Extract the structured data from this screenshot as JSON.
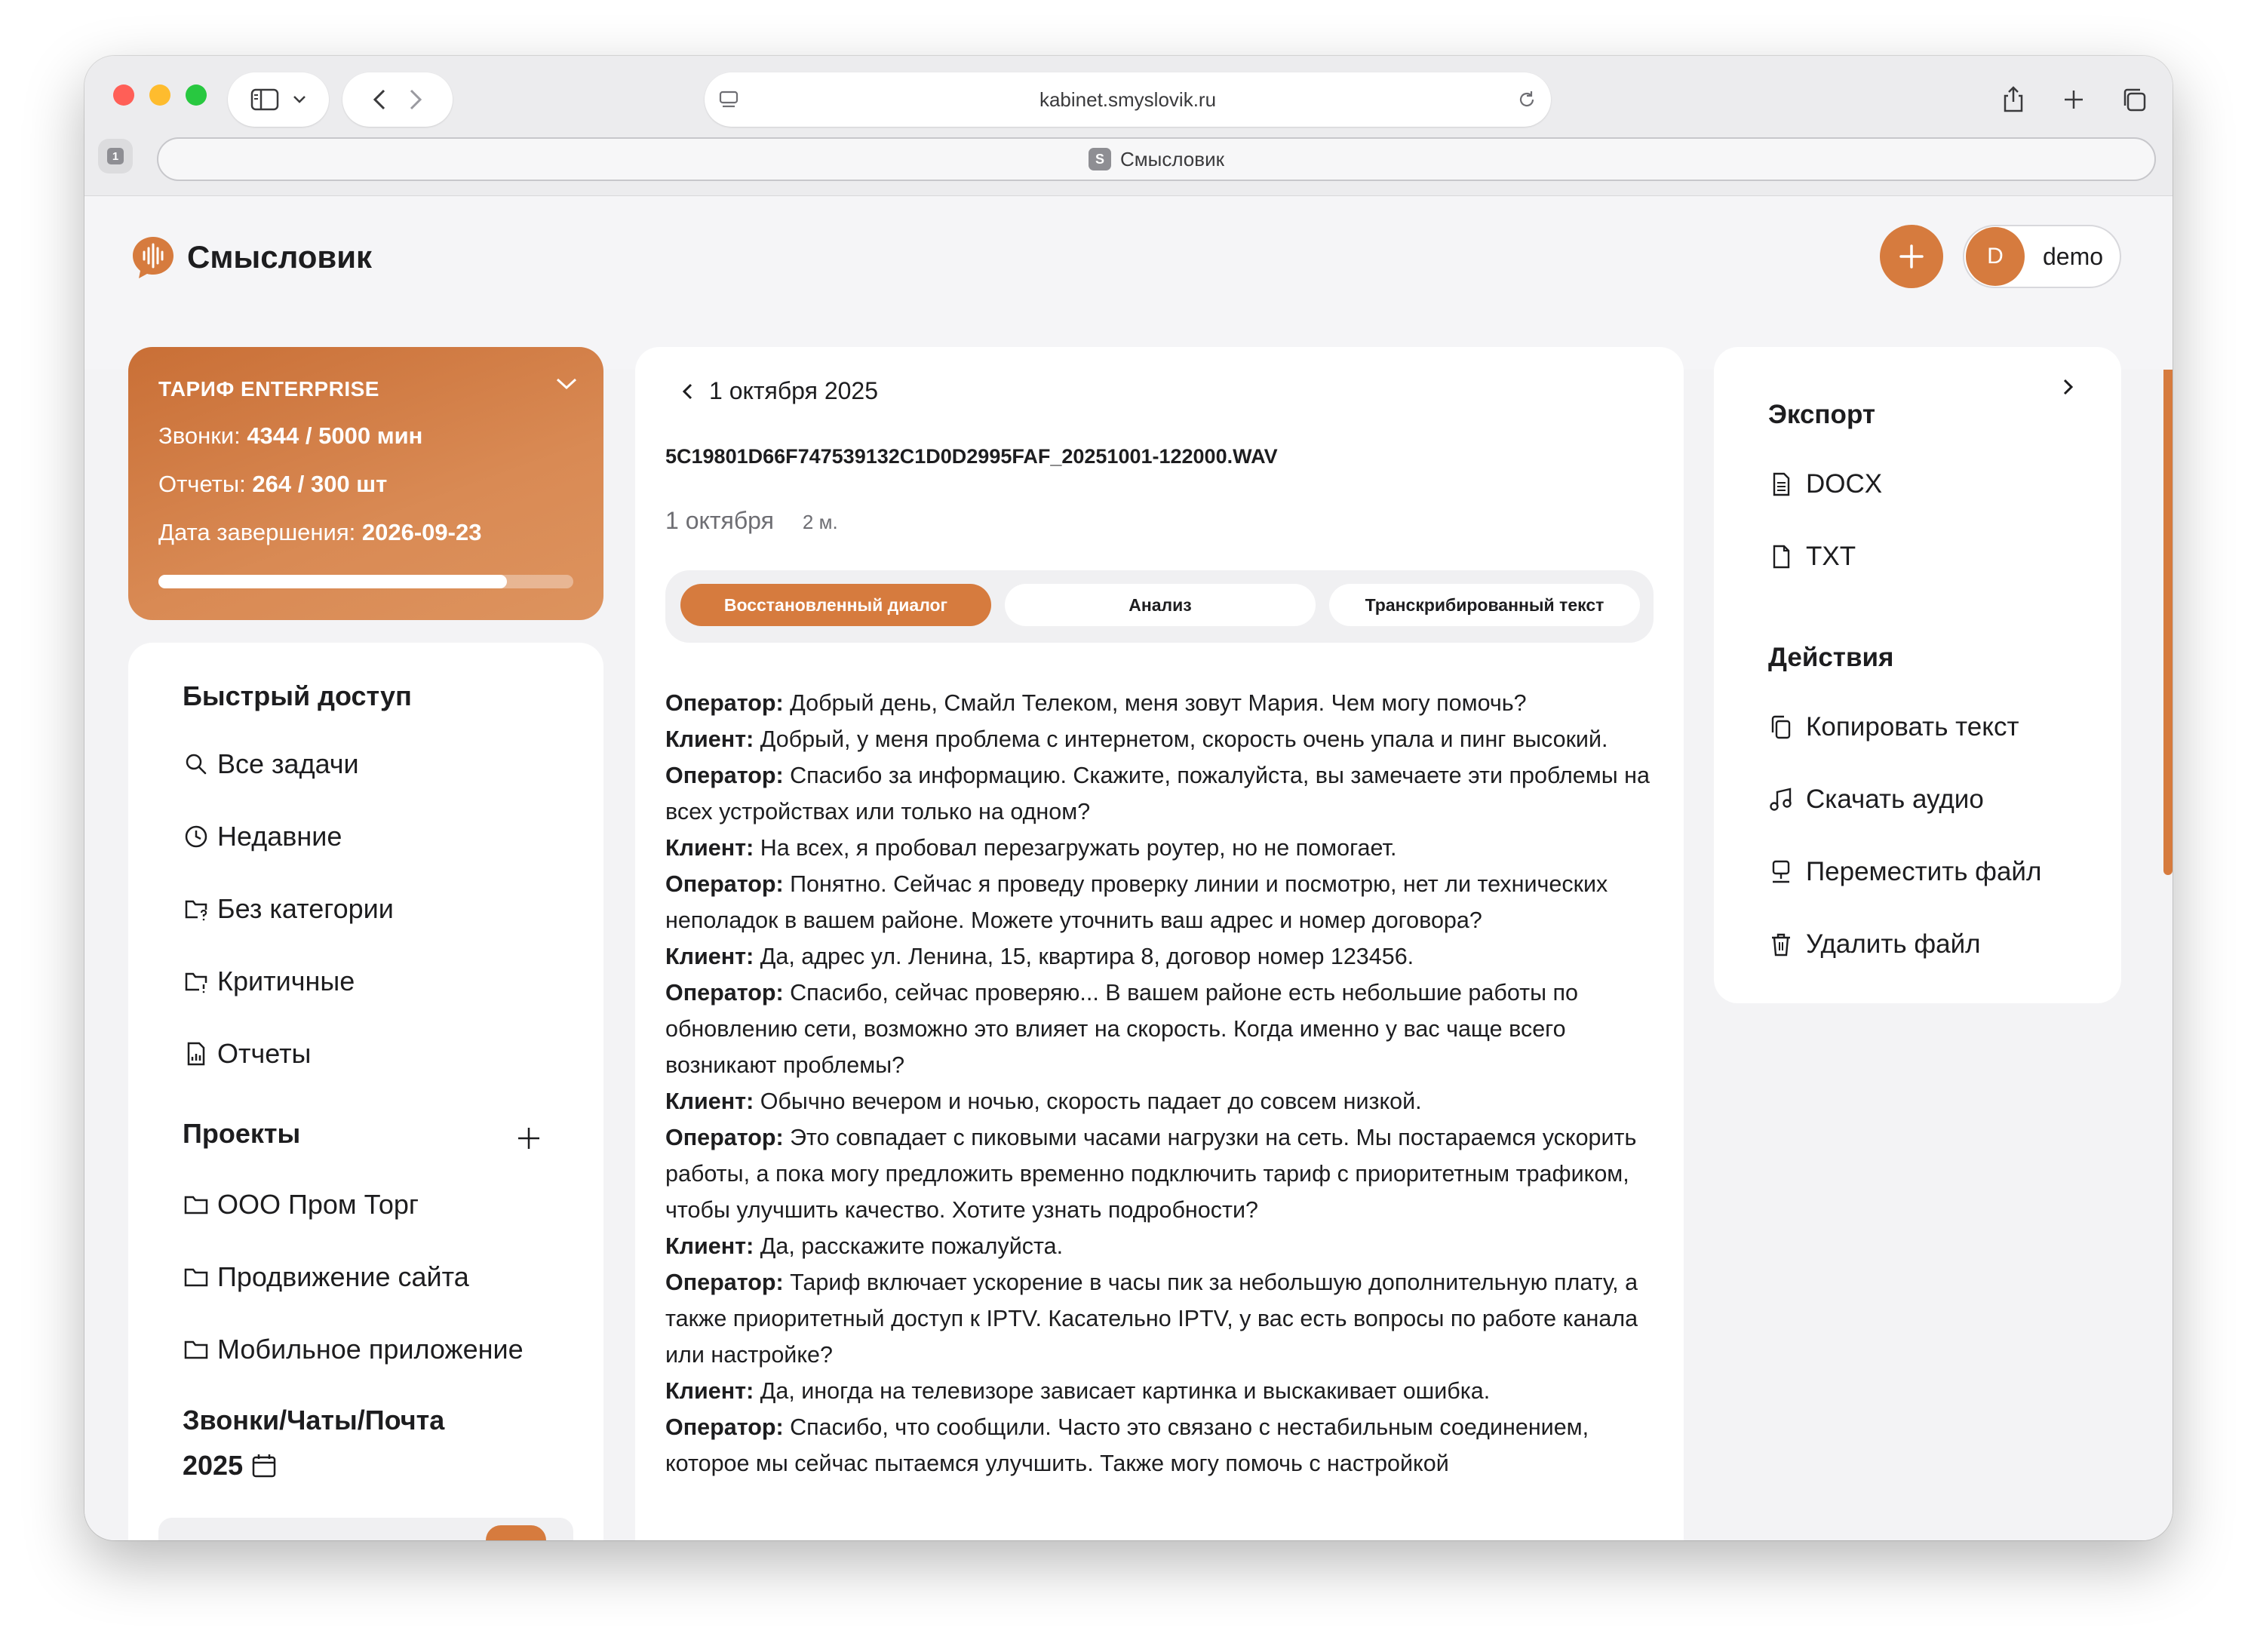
{
  "browser": {
    "url": "kabinet.smyslovik.ru",
    "tab_count": "1",
    "tab_title": "Смысловик",
    "favicon_letter": "S"
  },
  "app": {
    "logo_text": "Смысловик",
    "user": {
      "initial": "D",
      "name": "demo"
    },
    "accent_color": "#d67b3e"
  },
  "tariff": {
    "title": "ТАРИФ ENTERPRISE",
    "calls_label": "Звонки: ",
    "calls_value": "4344 / 5000 мин",
    "reports_label": "Отчеты: ",
    "reports_value": "264 / 300 шт",
    "end_label": "Дата завершения: ",
    "end_value": "2026-09-23",
    "usage_fraction": 0.84
  },
  "sidebar": {
    "quick_title": "Быстрый доступ",
    "quick_items": [
      {
        "label": "Все задачи",
        "icon": "search-icon"
      },
      {
        "label": "Недавние",
        "icon": "clock-icon"
      },
      {
        "label": "Без категории",
        "icon": "folder-question-icon"
      },
      {
        "label": "Критичные",
        "icon": "folder-alert-icon"
      },
      {
        "label": "Отчеты",
        "icon": "report-icon"
      }
    ],
    "projects_title": "Проекты",
    "projects": [
      {
        "label": "ООО Пром Торг",
        "icon": "folder-icon"
      },
      {
        "label": "Продвижение сайта",
        "icon": "folder-icon"
      },
      {
        "label": "Мобильное приложение",
        "icon": "folder-icon"
      }
    ],
    "calls_title": "Звонки/Чаты/Почта",
    "year": "2025"
  },
  "record": {
    "back_date": "1 октября 2025",
    "file_name": "5C19801D66F747539132C1D0D2995FAF_20251001-122000.WAV",
    "date": "1 октября",
    "duration": "2 м.",
    "tabs": [
      {
        "label": "Восстановленный диалог",
        "active": true
      },
      {
        "label": "Анализ",
        "active": false
      },
      {
        "label": "Транскрибированный текст",
        "active": false
      }
    ],
    "dialog": [
      {
        "speaker": "Оператор:",
        "text": " Добрый день, Смайл Телеком, меня зовут Мария. Чем могу помочь?"
      },
      {
        "speaker": "Клиент:",
        "text": " Добрый, у меня проблема с интернетом, скорость очень упала и пинг высокий."
      },
      {
        "speaker": "Оператор:",
        "text": " Спасибо за информацию. Скажите, пожалуйста, вы замечаете эти проблемы на всех устройствах или только на одном?"
      },
      {
        "speaker": "Клиент:",
        "text": " На всех, я пробовал перезагружать роутер, но не помогает."
      },
      {
        "speaker": "Оператор:",
        "text": " Понятно. Сейчас я проведу проверку линии и посмотрю, нет ли технических неполадок в вашем районе. Можете уточнить ваш адрес и номер договора?"
      },
      {
        "speaker": "Клиент:",
        "text": " Да, адрес ул. Ленина, 15, квартира 8, договор номер 123456."
      },
      {
        "speaker": "Оператор:",
        "text": " Спасибо, сейчас проверяю... В вашем районе есть небольшие работы по обновлению сети, возможно это влияет на скорость. Когда именно у вас чаще всего возникают проблемы?"
      },
      {
        "speaker": "Клиент:",
        "text": " Обычно вечером и ночью, скорость падает до совсем низкой."
      },
      {
        "speaker": "Оператор:",
        "text": " Это совпадает с пиковыми часами нагрузки на сеть. Мы постараемся ускорить работы, а пока могу предложить временно подключить тариф с приоритетным трафиком, чтобы улучшить качество. Хотите узнать подробности?"
      },
      {
        "speaker": "Клиент:",
        "text": " Да, расскажите пожалуйста."
      },
      {
        "speaker": "Оператор:",
        "text": " Тариф включает ускорение в часы пик за небольшую дополнительную плату, а также приоритетный доступ к IPTV. Касательно IPTV, у вас есть вопросы по работе канала или настройке?"
      },
      {
        "speaker": "Клиент:",
        "text": " Да, иногда на телевизоре зависает картинка и выскакивает ошибка."
      },
      {
        "speaker": "Оператор:",
        "text": " Спасибо, что сообщили. Часто это связано с нестабильным соединением, которое мы сейчас пытаемся улучшить. Также могу помочь с настройкой"
      }
    ]
  },
  "actions_panel": {
    "export_title": "Экспорт",
    "export_items": [
      {
        "label": "DOCX",
        "icon": "document-icon"
      },
      {
        "label": "TXT",
        "icon": "file-icon"
      }
    ],
    "actions_title": "Действия",
    "action_items": [
      {
        "label": "Копировать текст",
        "icon": "copy-icon"
      },
      {
        "label": "Скачать аудио",
        "icon": "music-icon"
      },
      {
        "label": "Переместить файл",
        "icon": "move-icon"
      },
      {
        "label": "Удалить файл",
        "icon": "trash-icon"
      }
    ]
  }
}
